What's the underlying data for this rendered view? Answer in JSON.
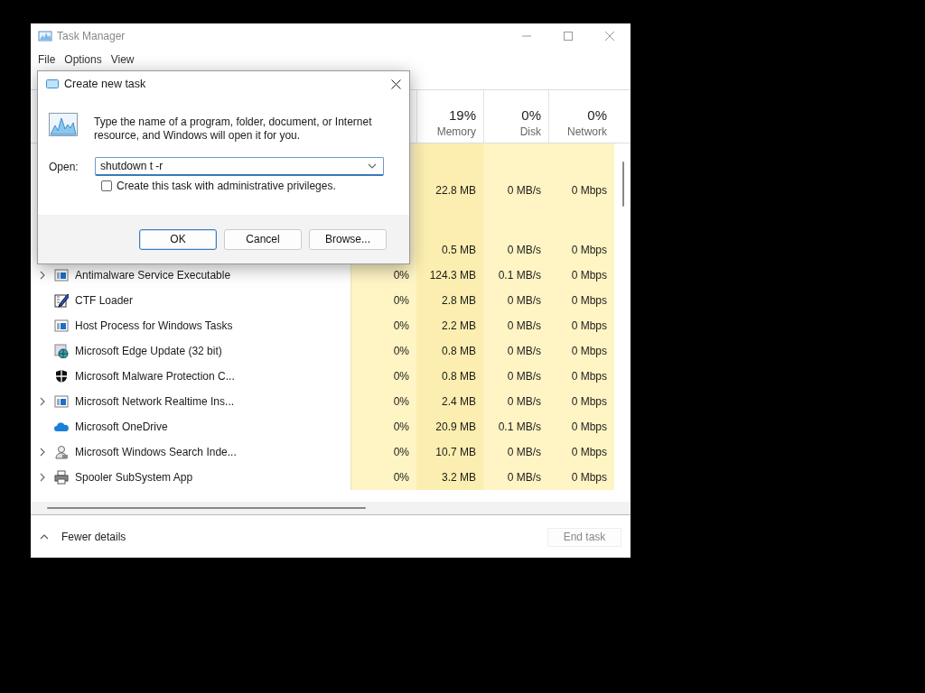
{
  "window": {
    "title": "Task Manager"
  },
  "menu": [
    "File",
    "Options",
    "View"
  ],
  "columns": [
    {
      "percent": "19%",
      "label": "Memory"
    },
    {
      "percent": "0%",
      "label": "Disk"
    },
    {
      "percent": "0%",
      "label": "Network"
    }
  ],
  "rows": [
    {
      "kind": "group"
    },
    {
      "kind": "covered",
      "memory": "22.8 MB",
      "disk": "0 MB/s",
      "network": "0 Mbps"
    },
    {
      "kind": "group"
    },
    {
      "kind": "covered",
      "memory": "0.5 MB",
      "disk": "0 MB/s",
      "network": "0 Mbps"
    },
    {
      "kind": "window",
      "name": "Antimalware Service Executable",
      "expandable": true,
      "cpu": "0%",
      "memory": "124.3 MB",
      "disk": "0.1 MB/s",
      "network": "0 Mbps"
    },
    {
      "kind": "pen",
      "name": "CTF Loader",
      "expandable": false,
      "cpu": "0%",
      "memory": "2.8 MB",
      "disk": "0 MB/s",
      "network": "0 Mbps"
    },
    {
      "kind": "window",
      "name": "Host Process for Windows Tasks",
      "expandable": false,
      "cpu": "0%",
      "memory": "2.2 MB",
      "disk": "0 MB/s",
      "network": "0 Mbps"
    },
    {
      "kind": "globe",
      "name": "Microsoft Edge Update (32 bit)",
      "expandable": false,
      "cpu": "0%",
      "memory": "0.8 MB",
      "disk": "0 MB/s",
      "network": "0 Mbps"
    },
    {
      "kind": "shield",
      "name": "Microsoft Malware Protection C...",
      "expandable": false,
      "cpu": "0%",
      "memory": "0.8 MB",
      "disk": "0 MB/s",
      "network": "0 Mbps"
    },
    {
      "kind": "window",
      "name": "Microsoft Network Realtime Ins...",
      "expandable": true,
      "cpu": "0%",
      "memory": "2.4 MB",
      "disk": "0 MB/s",
      "network": "0 Mbps"
    },
    {
      "kind": "cloud",
      "name": "Microsoft OneDrive",
      "expandable": false,
      "cpu": "0%",
      "memory": "20.9 MB",
      "disk": "0.1 MB/s",
      "network": "0 Mbps"
    },
    {
      "kind": "user",
      "name": "Microsoft Windows Search Inde...",
      "expandable": true,
      "cpu": "0%",
      "memory": "10.7 MB",
      "disk": "0 MB/s",
      "network": "0 Mbps"
    },
    {
      "kind": "printer",
      "name": "Spooler SubSystem App",
      "expandable": true,
      "cpu": "0%",
      "memory": "3.2 MB",
      "disk": "0 MB/s",
      "network": "0 Mbps"
    }
  ],
  "footer": {
    "details": "Fewer details",
    "end_task": {
      "label": "End task",
      "disabled": true
    }
  },
  "dialog": {
    "title": "Create new task",
    "message": "Type the name of a program, folder, document, or Internet resource, and Windows will open it for you.",
    "open_label": "Open:",
    "value": "shutdown t -r",
    "admin_checkbox": {
      "label": "Create this task with administrative privileges.",
      "checked": false
    },
    "buttons": [
      {
        "label": "OK",
        "default": true
      },
      {
        "label": "Cancel",
        "default": false
      },
      {
        "label": "Browse...",
        "default": false
      }
    ]
  }
}
